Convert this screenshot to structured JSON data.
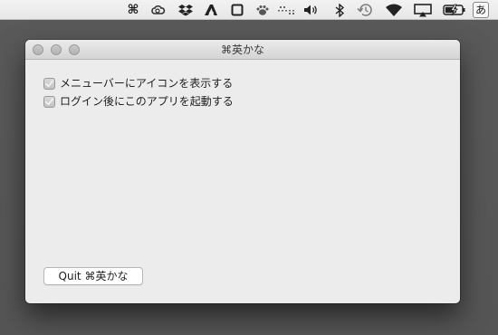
{
  "menubar": {
    "icons": [
      {
        "name": "command-icon"
      },
      {
        "name": "creative-cloud-icon"
      },
      {
        "name": "dropbox-icon"
      },
      {
        "name": "app-a-icon"
      },
      {
        "name": "square-outline-icon"
      },
      {
        "name": "paw-icon"
      },
      {
        "name": "keyboard-dots-icon"
      },
      {
        "name": "volume-icon"
      },
      {
        "name": "bluetooth-icon"
      },
      {
        "name": "time-machine-icon"
      },
      {
        "name": "wifi-icon"
      },
      {
        "name": "airplay-icon"
      },
      {
        "name": "battery-charging-icon"
      },
      {
        "name": "input-method-icon"
      }
    ],
    "input_method_label": "あ"
  },
  "window": {
    "title": "⌘英かな",
    "checkboxes": [
      {
        "label": "メニューバーにアイコンを表示する",
        "checked": true
      },
      {
        "label": "ログイン後にこのアプリを起動する",
        "checked": true
      }
    ],
    "quit_button_label": "Quit ⌘英かな"
  },
  "colors": {
    "desktop": "#575757",
    "window_bg": "#ececec",
    "menubar_bg": "#ececec"
  }
}
